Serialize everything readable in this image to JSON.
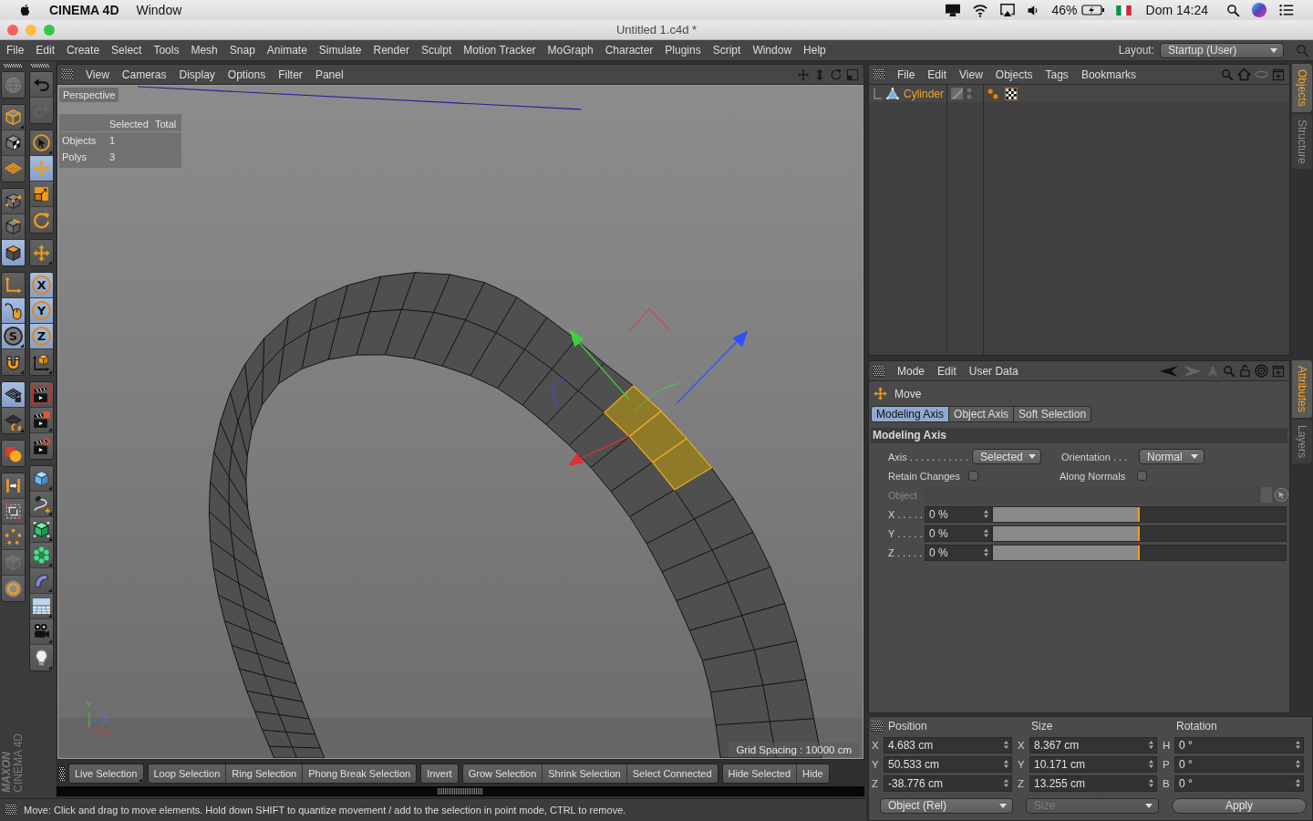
{
  "system_menubar": {
    "app_name": "CINEMA 4D",
    "menus": [
      "Window"
    ],
    "battery": "46%",
    "clock": "Dom 14:24"
  },
  "window": {
    "title": "Untitled 1.c4d *"
  },
  "main_menu": {
    "items": [
      "File",
      "Edit",
      "Create",
      "Select",
      "Tools",
      "Mesh",
      "Snap",
      "Animate",
      "Simulate",
      "Render",
      "Sculpt",
      "Motion Tracker",
      "MoGraph",
      "Character",
      "Plugins",
      "Script",
      "Window",
      "Help"
    ],
    "layout_label": "Layout:",
    "layout_value": "Startup (User)"
  },
  "left_toolbar": {
    "column_1": [
      [
        {
          "kind": "globe",
          "selected": false,
          "disabled": true,
          "menu": false
        }
      ],
      [
        {
          "kind": "model",
          "selected": false,
          "disabled": false,
          "menu": true
        },
        {
          "kind": "texture",
          "selected": false,
          "disabled": false,
          "menu": false
        },
        {
          "kind": "workplane",
          "selected": false,
          "disabled": false,
          "menu": false
        }
      ],
      [
        {
          "kind": "points",
          "selected": false,
          "disabled": false,
          "menu": false
        },
        {
          "kind": "edges",
          "selected": false,
          "disabled": false,
          "menu": false
        },
        {
          "kind": "polygons",
          "selected": true,
          "disabled": false,
          "menu": false
        }
      ],
      [
        {
          "kind": "axis",
          "selected": false,
          "disabled": false,
          "menu": false
        },
        {
          "kind": "tweak",
          "selected": true,
          "disabled": false,
          "menu": false
        },
        {
          "kind": "snap",
          "glyph": "S",
          "selected": true,
          "disabled": false,
          "menu": true
        },
        {
          "kind": "magnet",
          "selected": false,
          "disabled": false,
          "menu": true
        }
      ],
      [
        {
          "kind": "gridlock",
          "selected": true,
          "disabled": false,
          "menu": false
        },
        {
          "kind": "gridrotate",
          "selected": false,
          "disabled": false,
          "menu": true
        }
      ],
      [
        {
          "kind": "material",
          "selected": false,
          "disabled": false,
          "menu": false
        }
      ],
      [
        {
          "kind": "symmetry",
          "selected": false,
          "disabled": false,
          "menu": false
        },
        {
          "kind": "arrange",
          "selected": false,
          "disabled": false,
          "menu": false
        },
        {
          "kind": "pentagon",
          "selected": false,
          "disabled": false,
          "menu": false
        },
        {
          "kind": "cubegray",
          "selected": false,
          "disabled": true,
          "menu": false
        },
        {
          "kind": "ring",
          "selected": false,
          "disabled": false,
          "menu": false
        }
      ]
    ],
    "column_2": [
      [
        {
          "kind": "undo",
          "selected": false,
          "disabled": false,
          "menu": false
        },
        {
          "kind": "redo",
          "selected": false,
          "disabled": true,
          "menu": false
        }
      ],
      [
        {
          "kind": "selectlive",
          "selected": false,
          "disabled": false,
          "menu": true
        },
        {
          "kind": "move",
          "selected": true,
          "disabled": false,
          "menu": false
        },
        {
          "kind": "scale",
          "selected": false,
          "disabled": false,
          "menu": false
        },
        {
          "kind": "rotate",
          "selected": false,
          "disabled": false,
          "menu": false
        }
      ],
      [
        {
          "kind": "moveplus",
          "selected": false,
          "disabled": false,
          "menu": true
        }
      ],
      [
        {
          "kind": "lock",
          "glyph": "X",
          "selected": true,
          "disabled": false,
          "menu": false
        },
        {
          "kind": "lock",
          "glyph": "Y",
          "selected": true,
          "disabled": false,
          "menu": false
        },
        {
          "kind": "lock",
          "glyph": "Z",
          "selected": true,
          "disabled": false,
          "menu": false
        },
        {
          "kind": "coords",
          "selected": false,
          "disabled": false,
          "menu": true
        }
      ],
      [
        {
          "kind": "renderview",
          "selected": false,
          "disabled": false,
          "menu": false
        },
        {
          "kind": "renderregion",
          "selected": false,
          "disabled": false,
          "menu": true
        },
        {
          "kind": "rendersettings",
          "selected": false,
          "disabled": false,
          "menu": false
        }
      ],
      [
        {
          "kind": "cube",
          "selected": false,
          "disabled": false,
          "menu": true
        },
        {
          "kind": "pen",
          "selected": false,
          "disabled": false,
          "menu": true
        },
        {
          "kind": "subdivision",
          "selected": false,
          "disabled": false,
          "menu": true
        },
        {
          "kind": "cloner",
          "selected": false,
          "disabled": false,
          "menu": true
        },
        {
          "kind": "bend",
          "selected": false,
          "disabled": false,
          "menu": true
        },
        {
          "kind": "floor",
          "selected": false,
          "disabled": false,
          "menu": true
        },
        {
          "kind": "camera",
          "selected": false,
          "disabled": false,
          "menu": true
        },
        {
          "kind": "light",
          "selected": false,
          "disabled": false,
          "menu": true
        }
      ]
    ]
  },
  "logo": {
    "brand": "MAXON",
    "product": "CINEMA 4D"
  },
  "viewport": {
    "menu": [
      "View",
      "Cameras",
      "Display",
      "Options",
      "Filter",
      "Panel"
    ],
    "camera": "Perspective",
    "stats": {
      "headers": [
        "Selected",
        "Total"
      ],
      "rows": [
        {
          "label": "Objects",
          "value": "1"
        },
        {
          "label": "Polys",
          "value": "3"
        }
      ]
    },
    "axis_labels": [
      "Y",
      "Z",
      "X"
    ],
    "grid_spacing": "Grid Spacing : 10000 cm"
  },
  "bottom_toolbar": {
    "groups": [
      [
        {
          "label": "Live Selection",
          "menu": true
        }
      ],
      [
        {
          "label": "Loop Selection",
          "menu": false
        },
        {
          "label": "Ring Selection",
          "menu": false
        },
        {
          "label": "Phong Break Selection",
          "menu": false
        }
      ],
      [
        {
          "label": "Invert",
          "menu": false
        }
      ],
      [
        {
          "label": "Grow Selection",
          "menu": false
        },
        {
          "label": "Shrink Selection",
          "menu": false
        },
        {
          "label": "Select Connected",
          "menu": false
        }
      ],
      [
        {
          "label": "Hide Selected",
          "menu": false
        },
        {
          "label": "Hide",
          "menu": false
        }
      ]
    ]
  },
  "status_bar": {
    "text": "Move: Click and drag to move elements. Hold down SHIFT to quantize movement / add to the selection in point mode, CTRL to remove."
  },
  "object_manager": {
    "menu": [
      "File",
      "Edit",
      "View",
      "Objects",
      "Tags",
      "Bookmarks"
    ],
    "objects": [
      {
        "name": "Cylinder",
        "selected": true
      }
    ]
  },
  "side_tabs_top": [
    {
      "label": "Objects",
      "selected": true
    },
    {
      "label": "Structure",
      "selected": false
    }
  ],
  "attributes": {
    "menu": [
      "Mode",
      "Edit",
      "User Data"
    ],
    "tool": "Move",
    "tabs": [
      {
        "label": "Modeling Axis",
        "selected": true
      },
      {
        "label": "Object Axis",
        "selected": false
      },
      {
        "label": "Soft Selection",
        "selected": false
      }
    ],
    "section": "Modeling Axis",
    "axis": {
      "label": "Axis . . . . . . . . . . .",
      "value": "Selected"
    },
    "orientation": {
      "label": "Orientation . . .",
      "value": "Normal"
    },
    "retain_changes": {
      "label": "Retain Changes",
      "checked": false
    },
    "along_normals": {
      "label": "Along Normals",
      "checked": false
    },
    "object": {
      "label": "Object",
      "disabled": true
    },
    "sliders": [
      {
        "label": "X . . . . .",
        "value": "0 %",
        "level": 0.5
      },
      {
        "label": "Y . . . . .",
        "value": "0 %",
        "level": 0.5
      },
      {
        "label": "Z . . . . .",
        "value": "0 %",
        "level": 0.5
      }
    ]
  },
  "side_tabs_bottom": [
    {
      "label": "Attributes",
      "selected": true
    },
    {
      "label": "Layers",
      "selected": false
    }
  ],
  "coordinates": {
    "headers": [
      "Position",
      "Size",
      "Rotation"
    ],
    "rows": [
      [
        {
          "axis": "X",
          "value": "4.683 cm"
        },
        {
          "axis": "X",
          "value": "8.367 cm"
        },
        {
          "axis": "H",
          "value": "0 °"
        }
      ],
      [
        {
          "axis": "Y",
          "value": "50.533 cm"
        },
        {
          "axis": "Y",
          "value": "10.171 cm"
        },
        {
          "axis": "P",
          "value": "0 °"
        }
      ],
      [
        {
          "axis": "Z",
          "value": "-38.776 cm"
        },
        {
          "axis": "Z",
          "value": "13.255 cm"
        },
        {
          "axis": "B",
          "value": "0 °"
        }
      ]
    ],
    "mode": "Object (Rel)",
    "size_mode": {
      "value": "Size",
      "disabled": true
    },
    "apply": "Apply"
  }
}
